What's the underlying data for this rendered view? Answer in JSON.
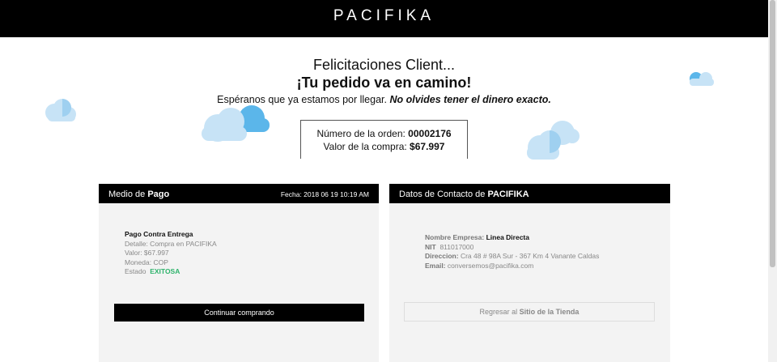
{
  "header": {
    "brand": "PACIFIKA"
  },
  "hero": {
    "greeting": "Felicitaciones Client...",
    "title": "¡Tu pedido va en camino!",
    "subtitle_plain": "Espéranos que ya estamos por llegar. ",
    "subtitle_emphasis": "No olvides tener el dinero exacto."
  },
  "order": {
    "number_label": "Número de la orden: ",
    "number_value": "00002176",
    "amount_label": "Valor de la compra: ",
    "amount_value": "$67.997"
  },
  "payment_card": {
    "title_plain": "Medio de ",
    "title_bold": "Pago",
    "date": "Fecha: 2018 06 19 10:19 AM",
    "method": "Pago Contra Entrega",
    "detail": "Detalle: Compra en PACIFIKA",
    "value": "Valor: $67.997",
    "currency": "Moneda: COP",
    "status_label": "Estado",
    "status_value": "EXITOSA",
    "button": "Continuar comprando"
  },
  "contact_card": {
    "title_plain": "Datos de Contacto de ",
    "title_bold": "PACIFIKA",
    "company_label": "Nombre Empresa: ",
    "company_value": "Linea Directa",
    "nit_label": "NIT",
    "nit_value": "811017000",
    "address_label": "Direccion:",
    "address_value": "Cra 48 # 98A Sur - 367 Km 4 Vanante Caldas",
    "email_label": "Email:",
    "email_value": "conversemos@pacifika.com",
    "button_plain": "Regresar al ",
    "button_bold": "Sitio de la Tienda"
  },
  "colors": {
    "header_bg": "#000000",
    "card_bg": "#f3f3f3",
    "success": "#2db36b",
    "cloud_light": "#c7e3f6",
    "cloud_dark": "#5bb6ea"
  },
  "icons": [
    "cloud-icon"
  ]
}
